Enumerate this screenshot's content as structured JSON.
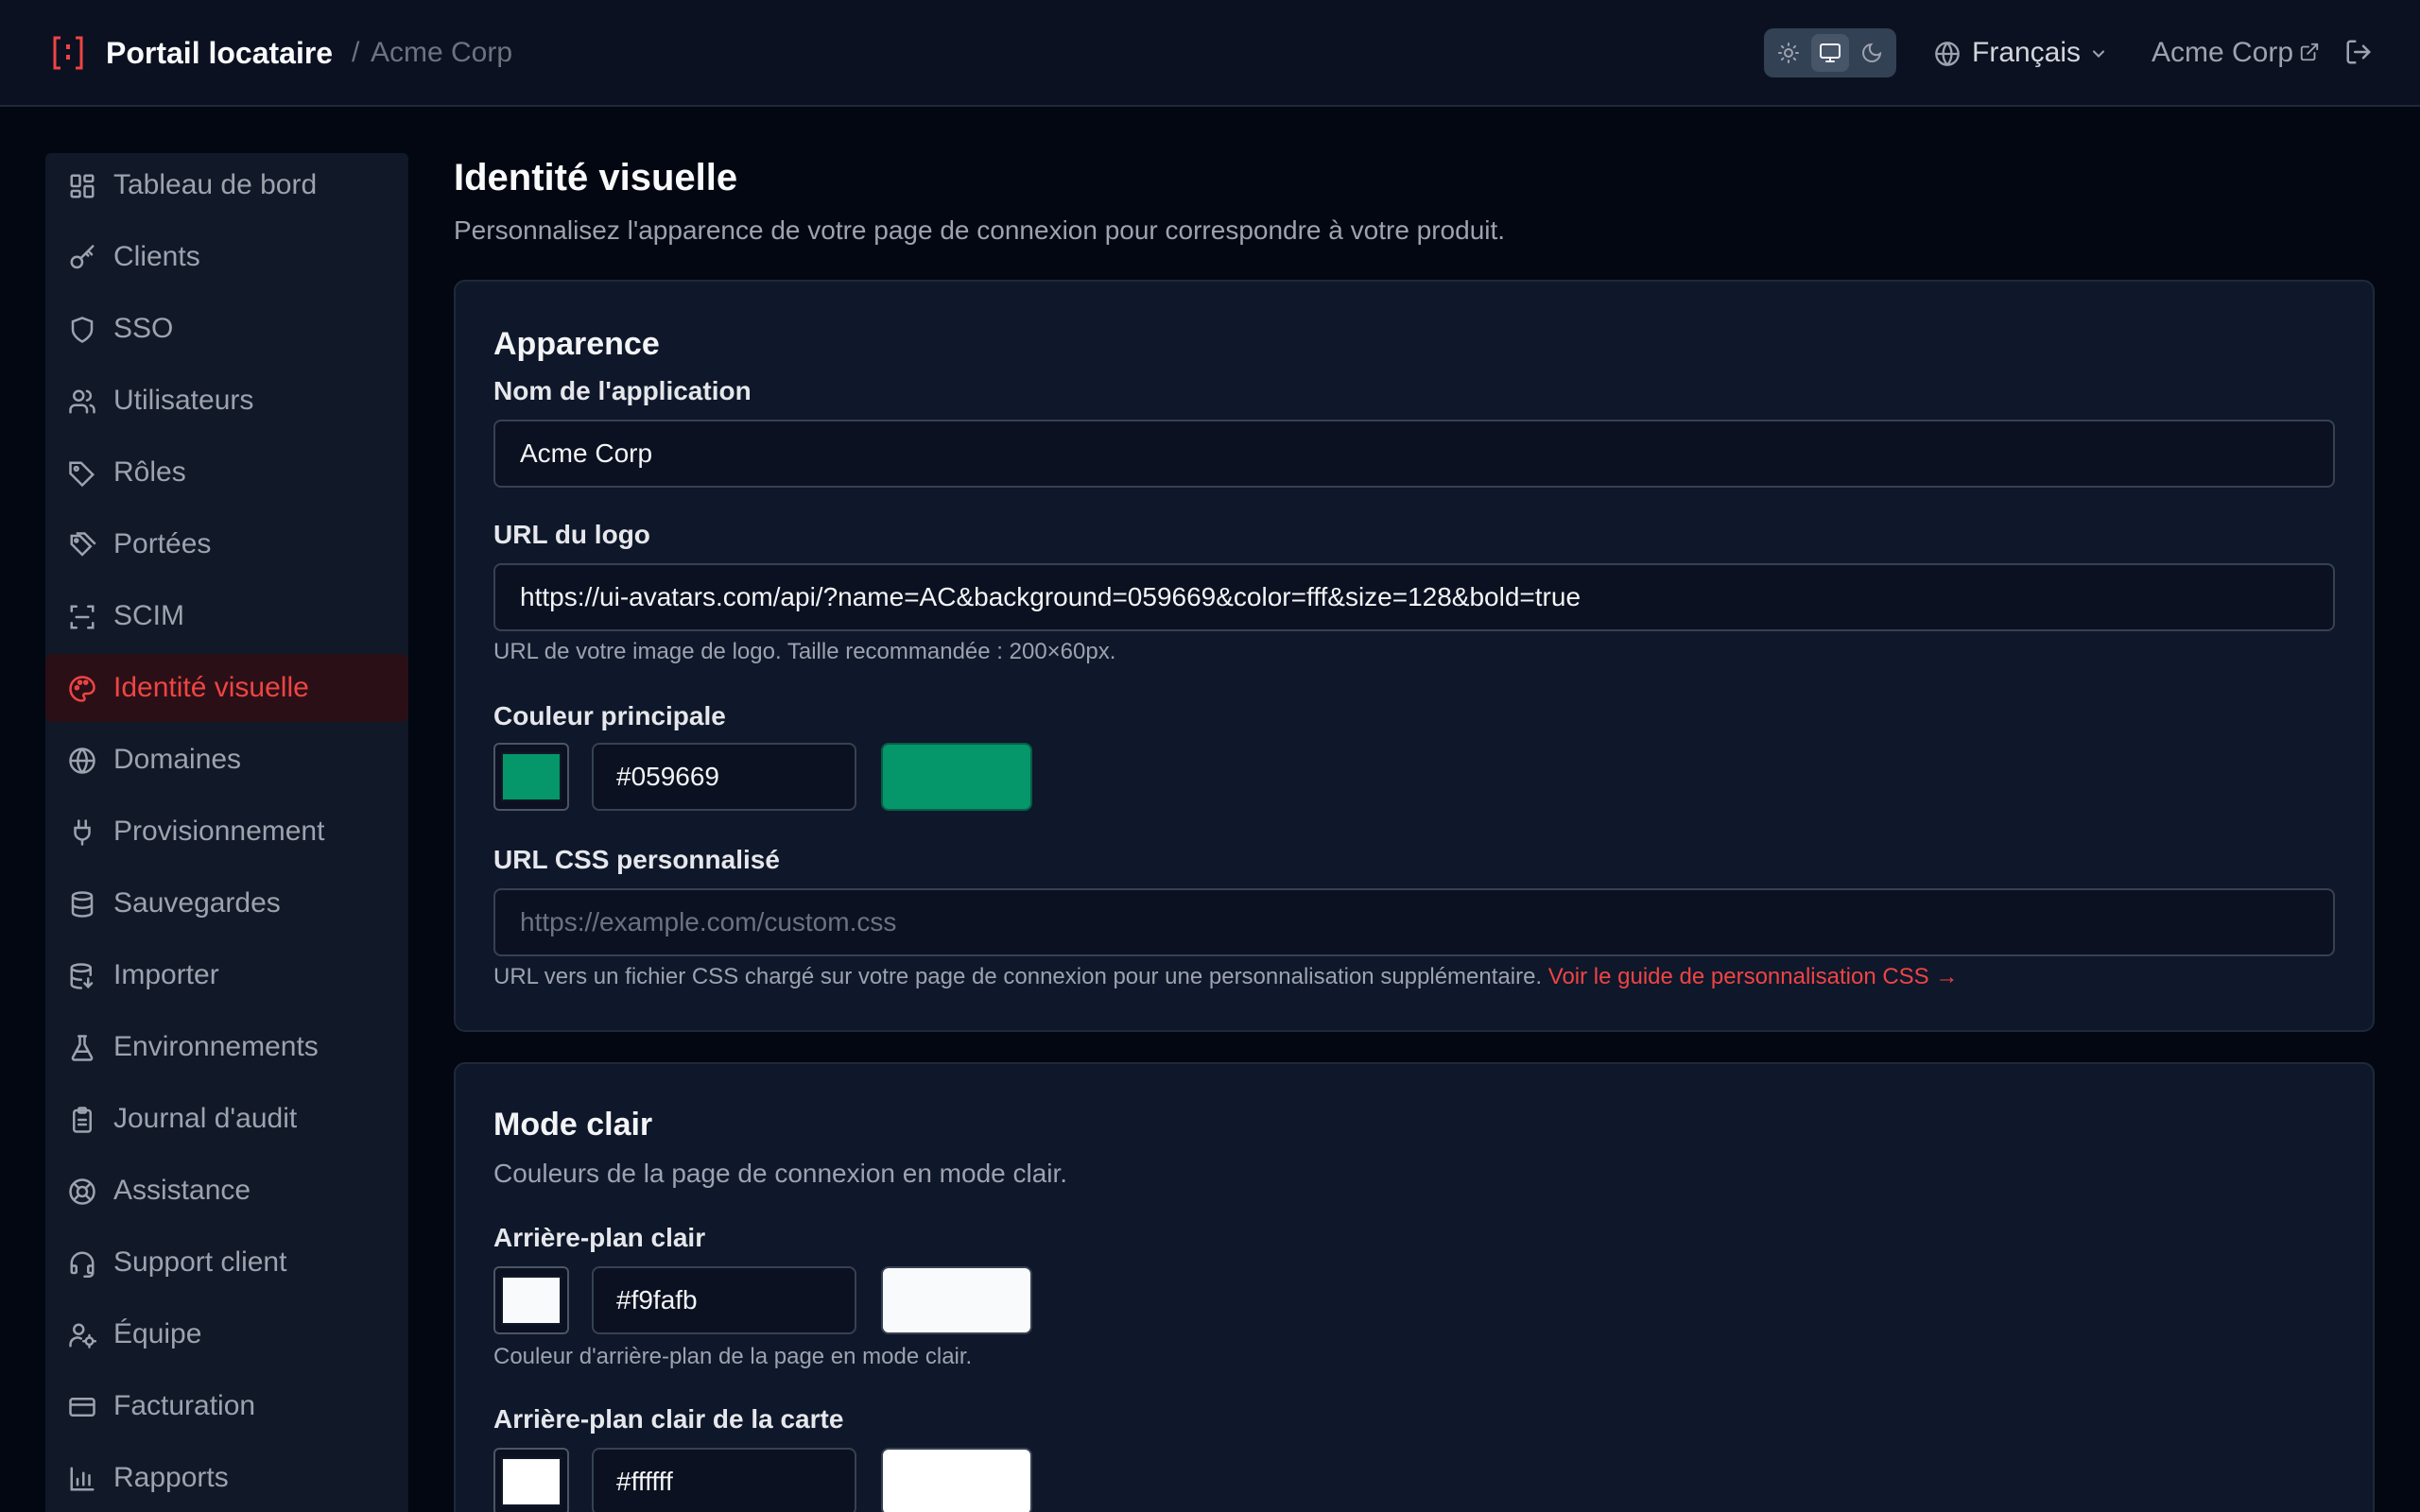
{
  "header": {
    "brand_title": "Portail locataire",
    "separator": "/",
    "tenant": "Acme Corp",
    "theme_options": [
      "light",
      "system",
      "dark"
    ],
    "theme_selected": "system",
    "language": "Français",
    "tenant_link": "Acme Corp",
    "accent_color": "#ef4444"
  },
  "sidebar": {
    "items": [
      {
        "label": "Tableau de bord",
        "icon": "dashboard-icon"
      },
      {
        "label": "Clients",
        "icon": "key-icon"
      },
      {
        "label": "SSO",
        "icon": "shield-icon"
      },
      {
        "label": "Utilisateurs",
        "icon": "users-icon"
      },
      {
        "label": "Rôles",
        "icon": "tag-icon"
      },
      {
        "label": "Portées",
        "icon": "tags-icon"
      },
      {
        "label": "SCIM",
        "icon": "scan-icon"
      },
      {
        "label": "Identité visuelle",
        "icon": "palette-icon",
        "active": true
      },
      {
        "label": "Domaines",
        "icon": "globe-icon"
      },
      {
        "label": "Provisionnement",
        "icon": "plug-icon"
      },
      {
        "label": "Sauvegardes",
        "icon": "database-icon"
      },
      {
        "label": "Importer",
        "icon": "database-import-icon"
      },
      {
        "label": "Environnements",
        "icon": "flask-icon"
      },
      {
        "label": "Journal d'audit",
        "icon": "clipboard-icon"
      },
      {
        "label": "Assistance",
        "icon": "lifebuoy-icon"
      },
      {
        "label": "Support client",
        "icon": "headset-icon"
      },
      {
        "label": "Équipe",
        "icon": "user-cog-icon"
      },
      {
        "label": "Facturation",
        "icon": "credit-card-icon"
      },
      {
        "label": "Rapports",
        "icon": "bar-chart-icon"
      }
    ]
  },
  "main": {
    "title": "Identité visuelle",
    "subtitle": "Personnalisez l'apparence de votre page de connexion pour correspondre à votre produit."
  },
  "appearance": {
    "title": "Apparence",
    "app_name_label": "Nom de l'application",
    "app_name_value": "Acme Corp",
    "logo_label": "URL du logo",
    "logo_value": "https://ui-avatars.com/api/?name=AC&background=059669&color=fff&size=128&bold=true",
    "logo_help": "URL de votre image de logo. Taille recommandée : 200×60px.",
    "primary_label": "Couleur principale",
    "primary_value": "#059669",
    "css_label": "URL CSS personnalisé",
    "css_placeholder": "https://example.com/custom.css",
    "css_help": "URL vers un fichier CSS chargé sur votre page de connexion pour une personnalisation supplémentaire.",
    "css_help_link": "Voir le guide de personnalisation CSS →"
  },
  "light_mode": {
    "title": "Mode clair",
    "description": "Couleurs de la page de connexion en mode clair.",
    "bg_label": "Arrière-plan clair",
    "bg_value": "#f9fafb",
    "bg_help": "Couleur d'arrière-plan de la page en mode clair.",
    "card_bg_label": "Arrière-plan clair de la carte",
    "card_bg_value": "#ffffff"
  }
}
